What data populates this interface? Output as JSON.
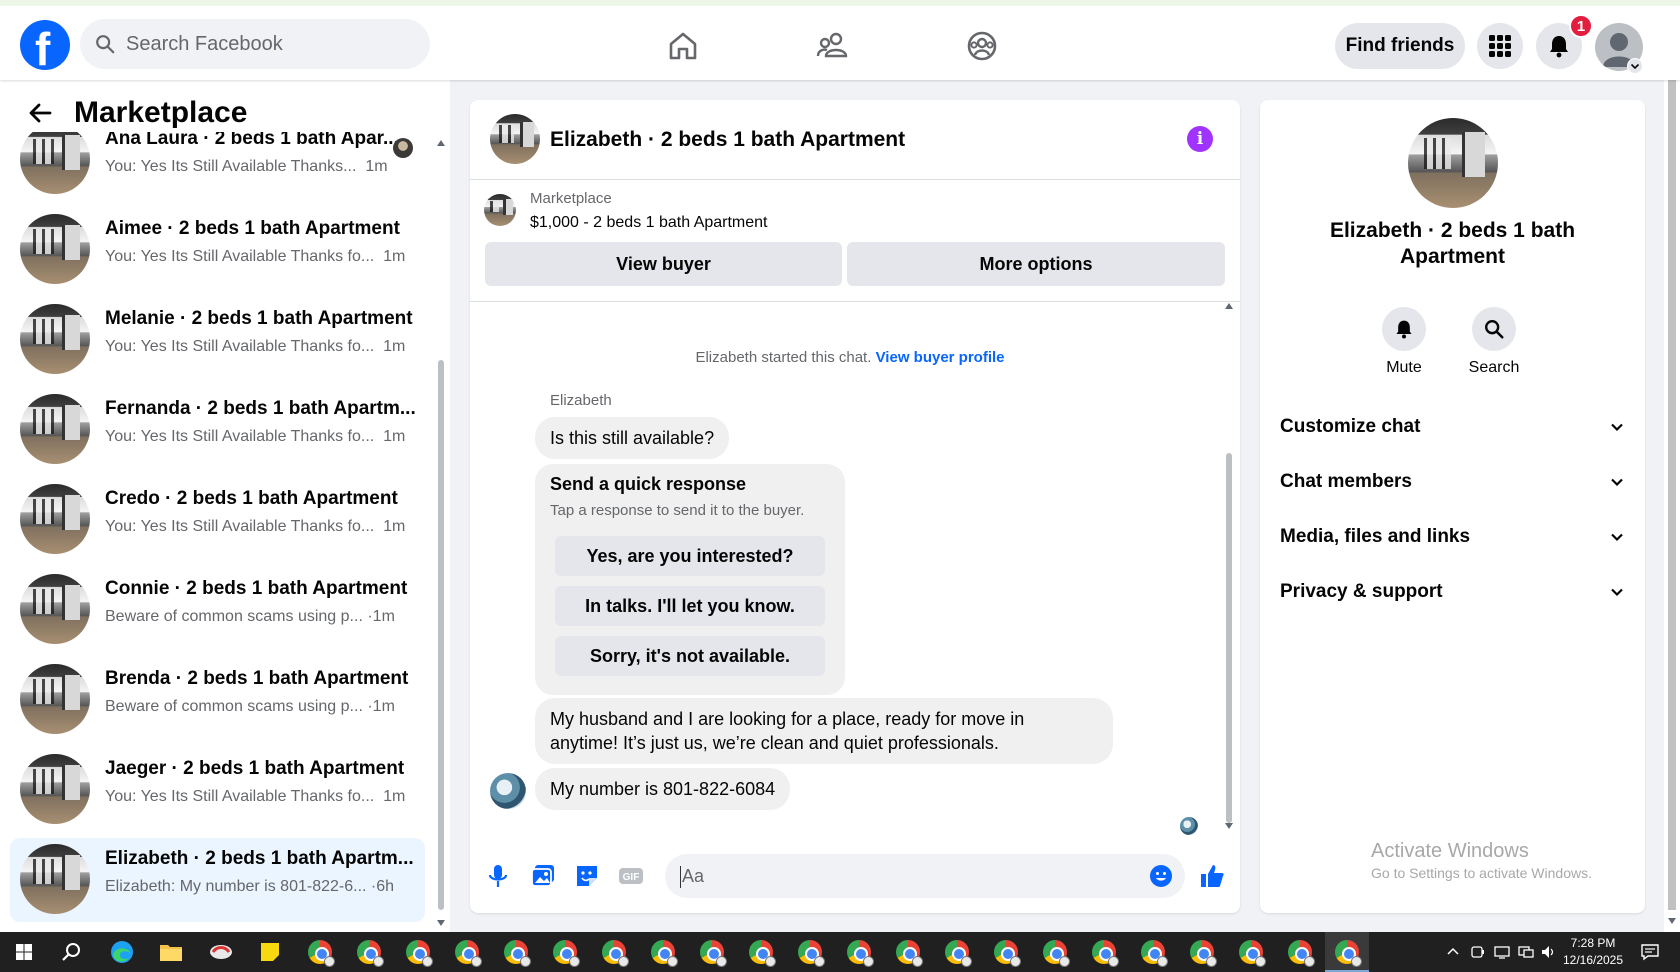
{
  "topbar": {
    "search_placeholder": "Search Facebook",
    "find_friends": "Find friends",
    "notification_count": "1"
  },
  "left": {
    "title": "Marketplace",
    "conversations": [
      {
        "name": "Ana Laura · 2 beds 1 bath Apar...",
        "preview": "You: Yes Its Still Available Thanks...",
        "time": "1m"
      },
      {
        "name": "Aimee · 2 beds 1 bath Apartment",
        "preview": "You: Yes Its Still Available Thanks fo...",
        "time": "1m"
      },
      {
        "name": "Melanie · 2 beds 1 bath Apartment",
        "preview": "You: Yes Its Still Available Thanks fo...",
        "time": "1m"
      },
      {
        "name": "Fernanda · 2 beds 1 bath Apartm...",
        "preview": "You: Yes Its Still Available Thanks fo...",
        "time": "1m"
      },
      {
        "name": "Credo · 2 beds 1 bath Apartment",
        "preview": "You: Yes Its Still Available Thanks fo...",
        "time": "1m"
      },
      {
        "name": "Connie · 2 beds 1 bath Apartment",
        "preview": "Beware of common scams using p...",
        "time": "·1m"
      },
      {
        "name": "Brenda · 2 beds 1 bath Apartment",
        "preview": "Beware of common scams using p...",
        "time": "·1m"
      },
      {
        "name": "Jaeger · 2 beds 1 bath Apartment",
        "preview": "You: Yes Its Still Available Thanks fo...",
        "time": "1m"
      },
      {
        "name": "Elizabeth · 2 beds 1 bath Apartm...",
        "preview": "Elizabeth: My number is 801-822-6...",
        "time": "·6h"
      }
    ]
  },
  "chat": {
    "title": "Elizabeth · 2 beds 1 bath Apartment",
    "listing_source": "Marketplace",
    "listing_price": "$1,000 - 2 beds 1 bath Apartment",
    "view_buyer": "View buyer",
    "more_options": "More options",
    "started_text": "Elizabeth started this chat.",
    "view_buyer_profile": "View buyer profile",
    "sender_name": "Elizabeth",
    "msg1": "Is this still available?",
    "quick_title": "Send a quick response",
    "quick_sub": "Tap a response to send it to the buyer.",
    "quick_options": [
      "Yes, are you interested?",
      "In talks. I'll let you know.",
      "Sorry, it's not available."
    ],
    "msg2_line1": "My husband and I are looking for a place, ready for move in",
    "msg2_line2": "anytime! It’s just us, we’re clean and quiet professionals.",
    "msg3": "My number is 801-822-6084",
    "input_placeholder": "Aa"
  },
  "details": {
    "title": "Elizabeth · 2 beds 1 bath Apartment",
    "mute": "Mute",
    "search": "Search",
    "sections": [
      "Customize chat",
      "Chat members",
      "Media, files and links",
      "Privacy & support"
    ]
  },
  "watermark": {
    "line1": "Activate Windows",
    "line2": "Go to Settings to activate Windows."
  },
  "taskbar": {
    "time": "7:28 PM",
    "date": "12/16/2025"
  },
  "colors": {
    "brand": "#0866ff",
    "info": "#a033ff",
    "badge": "#e41e3f"
  }
}
